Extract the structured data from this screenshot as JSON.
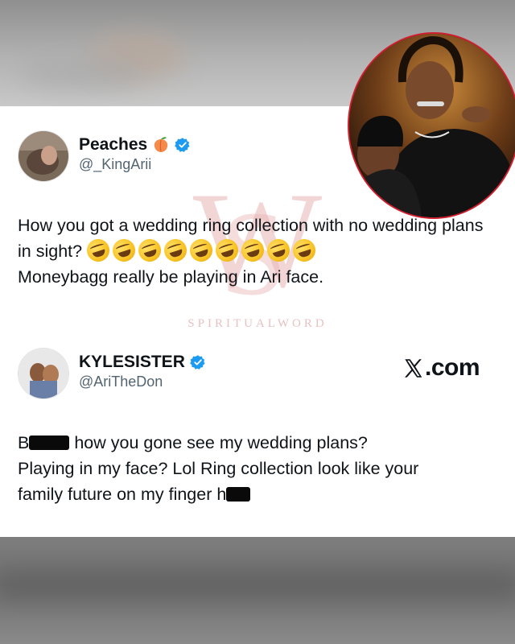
{
  "tweet1": {
    "name": "Peaches",
    "handle": "@_KingArii",
    "text": "How you got a wedding ring collection with no wedding plans in sight?",
    "line2": "Moneybagg really be playing in Ari face.",
    "emoji_count": 9,
    "emoji_icon": "rolling-on-floor-laughing-emoji",
    "name_emoji_icon": "peach-emoji"
  },
  "tweet2": {
    "name": "KYLESISTER",
    "handle": "@AriTheDon",
    "line1_after_redaction": "how you gone see my wedding plans?",
    "line1_prefix": "B",
    "line2": "Playing in my face? Lol Ring collection look like your",
    "line3": "family future on my finger h"
  },
  "source": {
    "label": ".com",
    "icon": "x-logo-icon"
  },
  "watermark": {
    "text": "SPIRITUALWORD",
    "letters": "SW"
  },
  "colors": {
    "verified": "#1d9bf0",
    "inset_border": "#d01f2f",
    "watermark": "#e9b6b6"
  }
}
